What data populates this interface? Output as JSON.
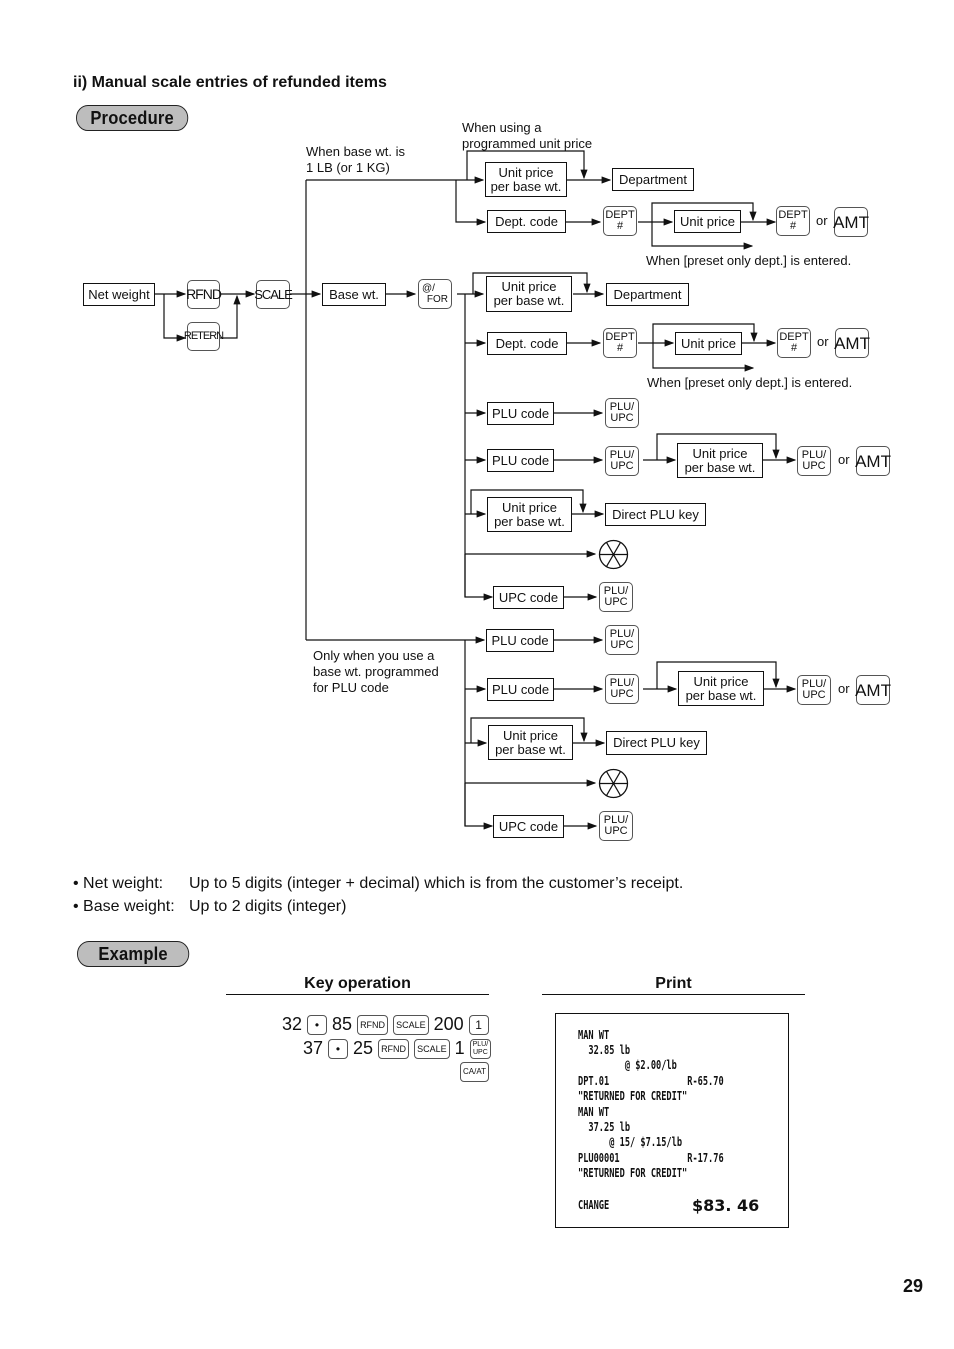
{
  "section_title": "ii) Manual scale entries of refunded items",
  "procedure_label": "Procedure",
  "example_label": "Example",
  "flow": {
    "labels": {
      "base_1lb": [
        "When base wt. is",
        "1 LB (or 1 KG)"
      ],
      "programmed_unit_price": [
        "When using a",
        "programmed unit price"
      ],
      "preset_only_dept_1": "When [preset only dept.] is entered.",
      "preset_only_dept_2": "When [preset only dept.] is entered.",
      "only_when_plu": [
        "Only when you use a",
        "base wt. programmed",
        "for PLU code"
      ],
      "or": "or"
    },
    "boxes": {
      "net_weight": "Net weight",
      "base_wt": "Base wt.",
      "unit_price_per_base": [
        "Unit price",
        "per base wt."
      ],
      "department": "Department",
      "dept_code": "Dept. code",
      "unit_price": "Unit price",
      "plu_code": "PLU code",
      "direct_plu_key": "Direct PLU key",
      "upc_code": "UPC code"
    },
    "keys": {
      "rfnd": "RFND",
      "retern": "RETERN",
      "scale": "SCALE",
      "at_for": [
        "@/",
        "FOR"
      ],
      "dept": [
        "DEPT",
        "#"
      ],
      "amt": "AMT",
      "plu_upc": [
        "PLU/",
        "UPC"
      ],
      "ca_at": "CA/AT",
      "dot": "•",
      "one": "1"
    }
  },
  "notes": [
    {
      "label": "• Net weight:",
      "text": "Up to 5 digits (integer + decimal) which is from the customer’s receipt."
    },
    {
      "label": "• Base weight:",
      "text": "Up to 2 digits (integer)"
    }
  ],
  "example": {
    "key_operation_header": "Key operation",
    "print_header": "Print",
    "line1": {
      "n1": "32",
      "n2": "85",
      "n3": "200"
    },
    "line2": {
      "n1": "37",
      "n2": "25",
      "n3": "1"
    },
    "receipt": [
      "MAN WT",
      "  32.85 lb",
      "         @ $2.00/lb",
      "DPT.01               R-65.70",
      "\"RETURNED FOR CREDIT\"",
      "MAN WT",
      "  37.25 lb",
      "      @ 15/ $7.15/lb",
      "PLU00001             R-17.76",
      "\"RETURNED FOR CREDIT\"",
      "",
      "CHANGE"
    ],
    "change_amount": "$83. 46"
  },
  "page_number": "29"
}
